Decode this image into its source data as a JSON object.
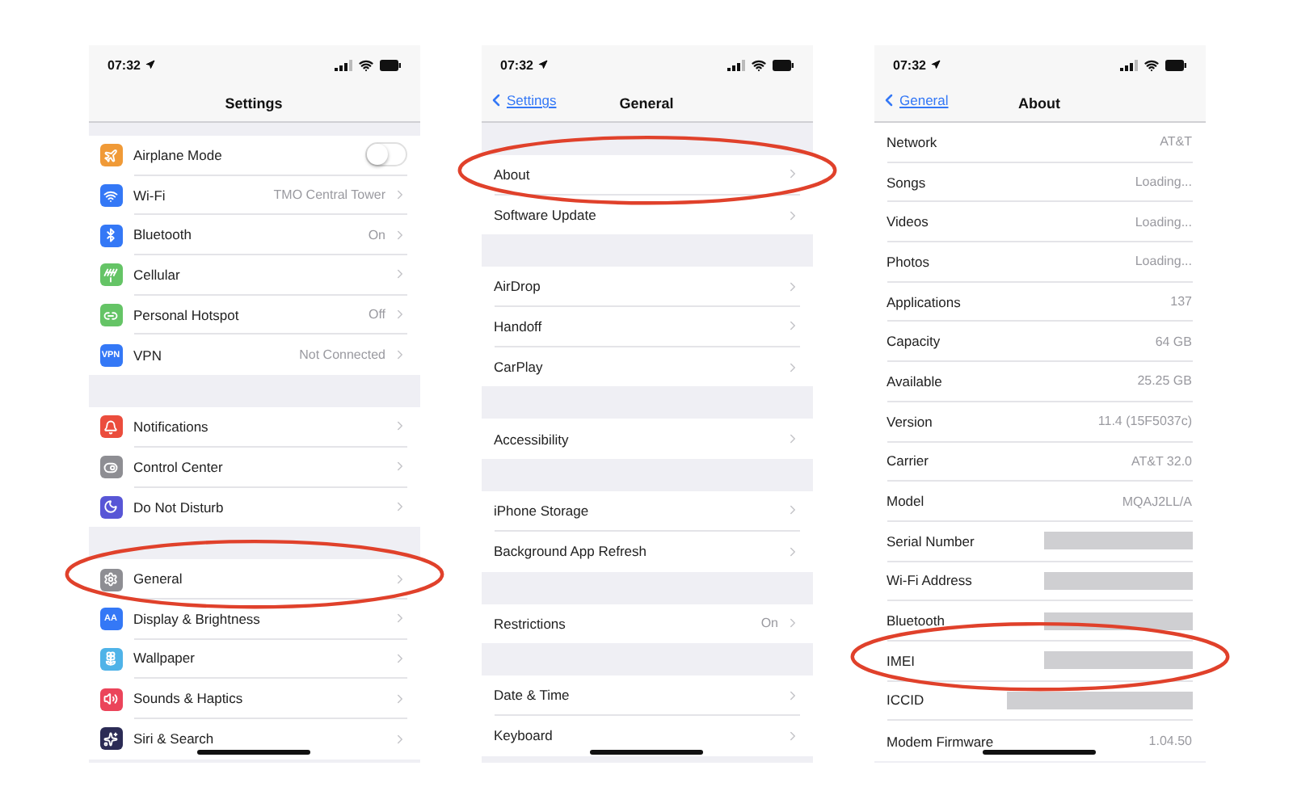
{
  "screens": [
    {
      "time": "07:32",
      "title": "Settings",
      "grouped": true,
      "sections": [
        {
          "rows": [
            {
              "kind": "switch",
              "label": "Airplane Mode",
              "on": false,
              "color": "#f09a37"
            },
            {
              "kind": "link",
              "label": "Wi-Fi",
              "value": "TMO Central Tower",
              "color": "#3478f6"
            },
            {
              "kind": "link",
              "label": "Bluetooth",
              "value": "On",
              "color": "#3478f6"
            },
            {
              "kind": "link",
              "label": "Cellular",
              "color": "#65c466"
            },
            {
              "kind": "link",
              "label": "Personal Hotspot",
              "value": "Off",
              "color": "#65c466"
            },
            {
              "kind": "link",
              "label": "VPN",
              "value": "Not Connected",
              "color": "#3478f6",
              "badge": "VPN"
            }
          ]
        },
        {
          "rows": [
            {
              "kind": "link",
              "label": "Notifications",
              "color": "#eb4d3d"
            },
            {
              "kind": "link",
              "label": "Control Center",
              "color": "#8e8e93"
            },
            {
              "kind": "link",
              "label": "Do Not Disturb",
              "color": "#5856d6"
            }
          ]
        },
        {
          "rows": [
            {
              "kind": "link",
              "label": "General",
              "color": "#8e8e93",
              "highlighted": true
            },
            {
              "kind": "link",
              "label": "Display & Brightness",
              "color": "#3478f6",
              "badge": "AA"
            },
            {
              "kind": "link",
              "label": "Wallpaper",
              "color": "#4fb3e8"
            },
            {
              "kind": "link",
              "label": "Sounds & Haptics",
              "color": "#eb445a"
            },
            {
              "kind": "link",
              "label": "Siri & Search",
              "color": "#2b2b55"
            }
          ]
        }
      ]
    },
    {
      "time": "07:32",
      "back": "Settings",
      "title": "General",
      "grouped": true,
      "sections": [
        {
          "rows": [
            {
              "kind": "link",
              "label": "About",
              "highlighted": true
            },
            {
              "kind": "link",
              "label": "Software Update"
            }
          ]
        },
        {
          "rows": [
            {
              "kind": "link",
              "label": "AirDrop"
            },
            {
              "kind": "link",
              "label": "Handoff"
            },
            {
              "kind": "link",
              "label": "CarPlay"
            }
          ]
        },
        {
          "rows": [
            {
              "kind": "link",
              "label": "Accessibility"
            }
          ]
        },
        {
          "rows": [
            {
              "kind": "link",
              "label": "iPhone Storage"
            },
            {
              "kind": "link",
              "label": "Background App Refresh"
            }
          ]
        },
        {
          "rows": [
            {
              "kind": "link",
              "label": "Restrictions",
              "value": "On"
            }
          ]
        },
        {
          "rows": [
            {
              "kind": "link",
              "label": "Date & Time"
            },
            {
              "kind": "link",
              "label": "Keyboard"
            }
          ]
        }
      ]
    },
    {
      "time": "07:32",
      "back": "General",
      "title": "About",
      "grouped": false,
      "sections": [
        {
          "rows": [
            {
              "kind": "info",
              "label": "Network",
              "value": "AT&T"
            },
            {
              "kind": "info",
              "label": "Songs",
              "value": "Loading..."
            },
            {
              "kind": "info",
              "label": "Videos",
              "value": "Loading..."
            },
            {
              "kind": "info",
              "label": "Photos",
              "value": "Loading..."
            },
            {
              "kind": "info",
              "label": "Applications",
              "value": "137"
            },
            {
              "kind": "info",
              "label": "Capacity",
              "value": "64 GB"
            },
            {
              "kind": "info",
              "label": "Available",
              "value": "25.25 GB"
            },
            {
              "kind": "info",
              "label": "Version",
              "value": "11.4 (15F5037c)"
            },
            {
              "kind": "info",
              "label": "Carrier",
              "value": "AT&T 32.0"
            },
            {
              "kind": "info",
              "label": "Model",
              "value": "MQAJ2LL/A"
            },
            {
              "kind": "info",
              "label": "Serial Number",
              "redacted": true
            },
            {
              "kind": "info",
              "label": "Wi-Fi Address",
              "redacted": true
            },
            {
              "kind": "info",
              "label": "Bluetooth",
              "redacted": true
            },
            {
              "kind": "info",
              "label": "IMEI",
              "redacted": true,
              "highlighted": true
            },
            {
              "kind": "info",
              "label": "ICCID",
              "redacted": true
            },
            {
              "kind": "info",
              "label": "Modem Firmware",
              "value": "1.04.50"
            }
          ]
        }
      ]
    }
  ]
}
